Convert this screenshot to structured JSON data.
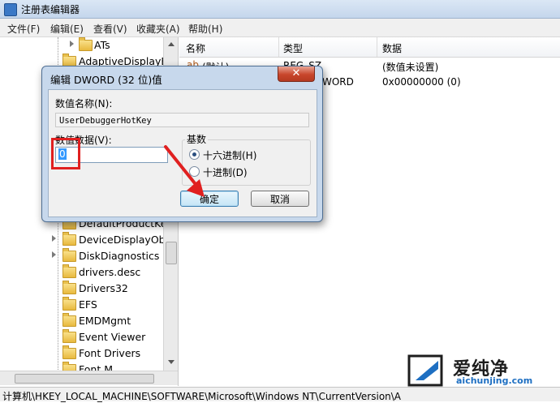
{
  "window": {
    "title": "注册表编辑器"
  },
  "menu": [
    "文件(F)",
    "编辑(E)",
    "查看(V)",
    "收藏夹(A)",
    "帮助(H)"
  ],
  "tree": {
    "items": [
      {
        "label": "ATs",
        "expandable": true
      },
      {
        "label": "AdaptiveDisplayBr",
        "expandable": false
      },
      {
        "label": "DefaultProductKey",
        "expandable": false
      },
      {
        "label": "DeviceDisplayObje",
        "expandable": true
      },
      {
        "label": "DiskDiagnostics",
        "expandable": true
      },
      {
        "label": "drivers.desc",
        "expandable": false
      },
      {
        "label": "Drivers32",
        "expandable": false
      },
      {
        "label": "EFS",
        "expandable": false
      },
      {
        "label": "EMDMgmt",
        "expandable": false
      },
      {
        "label": "Event Viewer",
        "expandable": false
      },
      {
        "label": "Font Drivers",
        "expandable": false
      },
      {
        "label": "Font M",
        "expandable": false
      }
    ]
  },
  "list": {
    "headers": [
      "名称",
      "类型",
      "数据"
    ],
    "rows": [
      {
        "name": "(默认)",
        "type": "REG_SZ",
        "data": "(数值未设置)"
      },
      {
        "name": "",
        "type": "WORD",
        "data": "0x00000000 (0)"
      }
    ]
  },
  "dialog": {
    "title": "编辑 DWORD (32 位)值",
    "close_label": "✕",
    "name_label": "数值名称(N):",
    "name_value": "UserDebuggerHotKey",
    "data_label": "数值数据(V):",
    "data_value": "0",
    "base_label": "基数",
    "radios": [
      {
        "label": "十六进制(H)",
        "checked": true
      },
      {
        "label": "十进制(D)",
        "checked": false
      }
    ],
    "ok_label": "确定",
    "cancel_label": "取消"
  },
  "status": {
    "path": "计算机\\HKEY_LOCAL_MACHINE\\SOFTWARE\\Microsoft\\Windows NT\\CurrentVersion\\A"
  },
  "watermark": {
    "name": "爱纯净",
    "url": "aichunjing.com"
  },
  "colors": {
    "highlight": "#e02020",
    "selection": "#3399ff",
    "dialog_frame": "#c7d8ec"
  }
}
